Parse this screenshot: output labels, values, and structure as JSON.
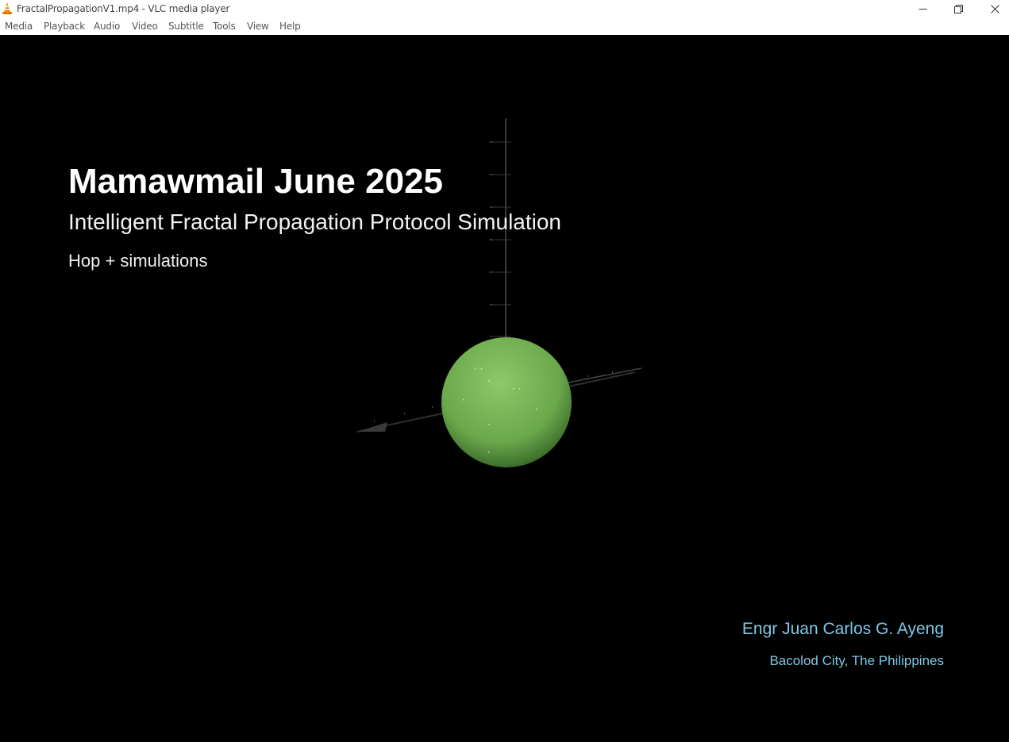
{
  "window": {
    "title": "FractalPropagationV1.mp4 - VLC media player",
    "minimize_icon": "minimize-icon",
    "restore_icon": "restore-icon",
    "close_icon": "close-icon"
  },
  "menu": {
    "items": [
      {
        "label": "Media"
      },
      {
        "label": "Playback"
      },
      {
        "label": "Audio"
      },
      {
        "label": "Video"
      },
      {
        "label": "Subtitle"
      },
      {
        "label": "Tools"
      },
      {
        "label": "View"
      },
      {
        "label": "Help"
      }
    ]
  },
  "video": {
    "title": "Mamawmail June 2025",
    "subtitle": "Intelligent Fractal Propagation Protocol Simulation",
    "tagline": "Hop + simulations",
    "author": "Engr Juan Carlos G. Ayeng",
    "location": "Bacolod City, The Philippines",
    "sphere_color": "#7ab85a",
    "credit_color": "#7ec8e6"
  }
}
